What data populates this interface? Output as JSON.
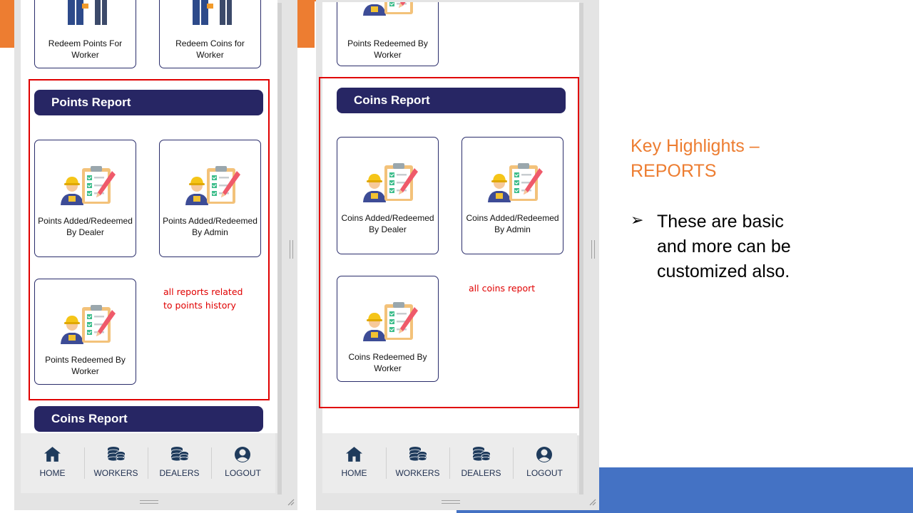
{
  "phone_left": {
    "top_tiles": [
      {
        "label": "Redeem Points For Worker"
      },
      {
        "label": "Redeem Coins for Worker"
      }
    ],
    "section_title": "Points Report",
    "tiles": [
      {
        "label": "Points Added/Redeemed By Dealer",
        "icon": "report-clipboard-icon"
      },
      {
        "label": "Points Added/Redeemed By Admin",
        "icon": "report-clipboard-icon"
      },
      {
        "label": "Points Redeemed By Worker",
        "icon": "report-clipboard-icon"
      }
    ],
    "annotation": [
      "all reports related",
      "to points history"
    ],
    "next_section_title": "Coins Report"
  },
  "phone_right": {
    "top_tile": {
      "label": "Points Redeemed By Worker"
    },
    "section_title": "Coins Report",
    "tiles": [
      {
        "label": "Coins Added/Redeemed By Dealer",
        "icon": "report-clipboard-icon"
      },
      {
        "label": "Coins Added/Redeemed By Admin",
        "icon": "report-clipboard-icon"
      },
      {
        "label": "Coins Redeemed By Worker",
        "icon": "report-clipboard-icon"
      }
    ],
    "annotation": "all coins report"
  },
  "bottom_nav": {
    "items": [
      {
        "label": "HOME",
        "icon": "home-icon"
      },
      {
        "label": "WORKERS",
        "icon": "coins-stack-icon"
      },
      {
        "label": "DEALERS",
        "icon": "coins-stack-icon"
      },
      {
        "label": "LOGOUT",
        "icon": "user-circle-icon"
      }
    ]
  },
  "highlights": {
    "title_line1": "Key Highlights –",
    "title_line2": "REPORTS",
    "bullet_symbol": "➢",
    "bullet_text": "These are basic and more can be customized also."
  },
  "colors": {
    "header_bg": "#272664",
    "accent_orange": "#ed7d31",
    "accent_blue": "#4472c4",
    "annotation_red": "#e00000",
    "nav_icon": "#1f3b5c"
  }
}
